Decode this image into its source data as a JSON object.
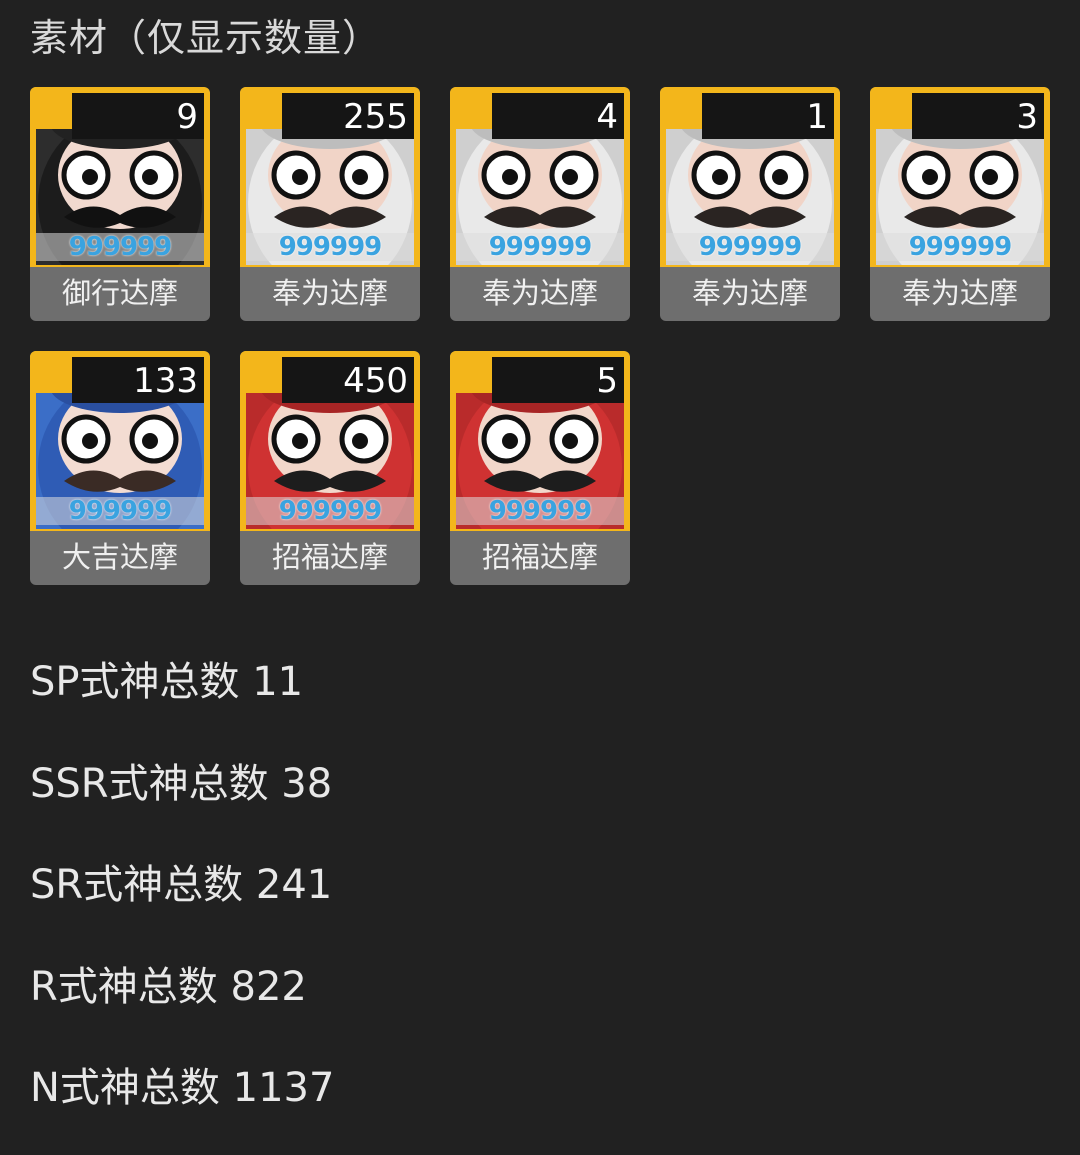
{
  "section": {
    "title": "素材（仅显示数量）"
  },
  "materials": [
    {
      "name": "御行达摩",
      "count": "9",
      "level": "999999",
      "variant": "black"
    },
    {
      "name": "奉为达摩",
      "count": "255",
      "level": "999999",
      "variant": "white"
    },
    {
      "name": "奉为达摩",
      "count": "4",
      "level": "999999",
      "variant": "white"
    },
    {
      "name": "奉为达摩",
      "count": "1",
      "level": "999999",
      "variant": "white"
    },
    {
      "name": "奉为达摩",
      "count": "3",
      "level": "999999",
      "variant": "white"
    },
    {
      "name": "大吉达摩",
      "count": "133",
      "level": "999999",
      "variant": "blue"
    },
    {
      "name": "招福达摩",
      "count": "450",
      "level": "999999",
      "variant": "red"
    },
    {
      "name": "招福达摩",
      "count": "5",
      "level": "999999",
      "variant": "red"
    }
  ],
  "stats": [
    {
      "label": "SP式神总数 11"
    },
    {
      "label": "SSR式神总数 38"
    },
    {
      "label": "SR式神总数 241"
    },
    {
      "label": "R式神总数 822"
    },
    {
      "label": "N式神总数 1137"
    }
  ],
  "colors": {
    "background": "#212121",
    "frame": "#f3b61b",
    "level_text": "#3aa3e0",
    "name_bar": "#6e6e6e"
  }
}
